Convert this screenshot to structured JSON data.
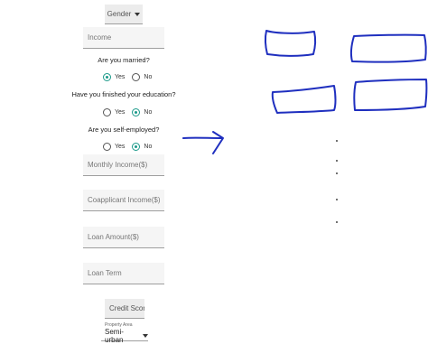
{
  "form": {
    "gender_label": "Gender",
    "income_placeholder": "Income",
    "married_question": "Are you married?",
    "education_question": "Have you finished your education?",
    "self_employed_question": "Are you self-employed?",
    "yes_label": "Yes",
    "no_label": "No",
    "married_selected": "Yes",
    "education_selected": "No",
    "self_employed_selected": "No",
    "monthly_income_placeholder": "Monthly Income($)",
    "coapplicant_income_placeholder": "Coapplicant Income($)",
    "loan_amount_placeholder": "Loan Amount($)",
    "loan_term_placeholder": "Loan Term",
    "credit_score_label": "Credit Score",
    "property_area_label": "Property Area",
    "property_area_value": "Semi-urban"
  },
  "colors": {
    "accent": "#1b9a8a",
    "ink": "#1f2fbf"
  }
}
